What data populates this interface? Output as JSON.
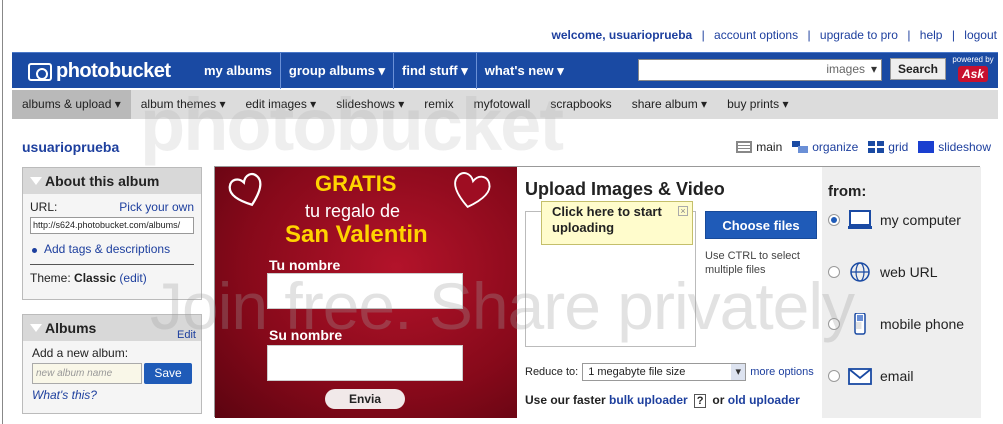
{
  "topbar": {
    "welcome": "welcome, usuarioprueba",
    "links": [
      "account options",
      "upgrade to pro",
      "help",
      "logout"
    ]
  },
  "header": {
    "logo_text": "photobucket",
    "nav": [
      "my albums",
      "group albums ▾",
      "find stuff ▾",
      "what's new ▾"
    ],
    "search_scope": "images",
    "search_button": "Search",
    "powered_by": "powered by",
    "ask_logo": "Ask"
  },
  "subnav": [
    "albums & upload ▾",
    "album themes ▾",
    "edit images ▾",
    "slideshows ▾",
    "remix",
    "myfotowall",
    "scrapbooks",
    "share album ▾",
    "buy prints ▾"
  ],
  "watermark": {
    "top": "photobucket",
    "bottom": "Join free. Share privately."
  },
  "username": "usuarioprueba",
  "views": [
    "main",
    "organize",
    "grid",
    "slideshow"
  ],
  "about": {
    "title": "About this album",
    "url_label": "URL:",
    "pick_own": "Pick your own",
    "url_value": "http://s624.photobucket.com/albums/",
    "tags_link": "Add tags & descriptions",
    "theme_label": "Theme:",
    "theme_value": "Classic",
    "theme_edit": "(edit)"
  },
  "albums": {
    "title": "Albums",
    "edit": "Edit",
    "add_label": "Add a new album:",
    "placeholder": "new album name",
    "save": "Save",
    "whats_this": "What's this?"
  },
  "ad": {
    "gratis": "GRATIS",
    "regalo": "tu regalo de",
    "san_valentin": "San Valentin",
    "name1": "Tu nombre",
    "name2": "Su nombre",
    "envia": "Envia"
  },
  "upload": {
    "title": "Upload Images & Video",
    "tooltip": "Click here to start uploading",
    "choose": "Choose files",
    "hint": "Use CTRL to select multiple files",
    "reduce_label": "Reduce to:",
    "reduce_value": "1 megabyte file size",
    "more_options": "more options",
    "bulk_prefix": "Use our faster",
    "bulk_link": "bulk uploader",
    "help_q": "?",
    "or": "or",
    "old_link": "old uploader"
  },
  "from": {
    "title": "from:",
    "options": [
      "my computer",
      "web URL",
      "mobile phone",
      "email"
    ],
    "selected": "my computer"
  },
  "colors": {
    "brand_blue": "#1a4aa3",
    "link": "#1d3f9e",
    "button": "#1f5bb8"
  }
}
